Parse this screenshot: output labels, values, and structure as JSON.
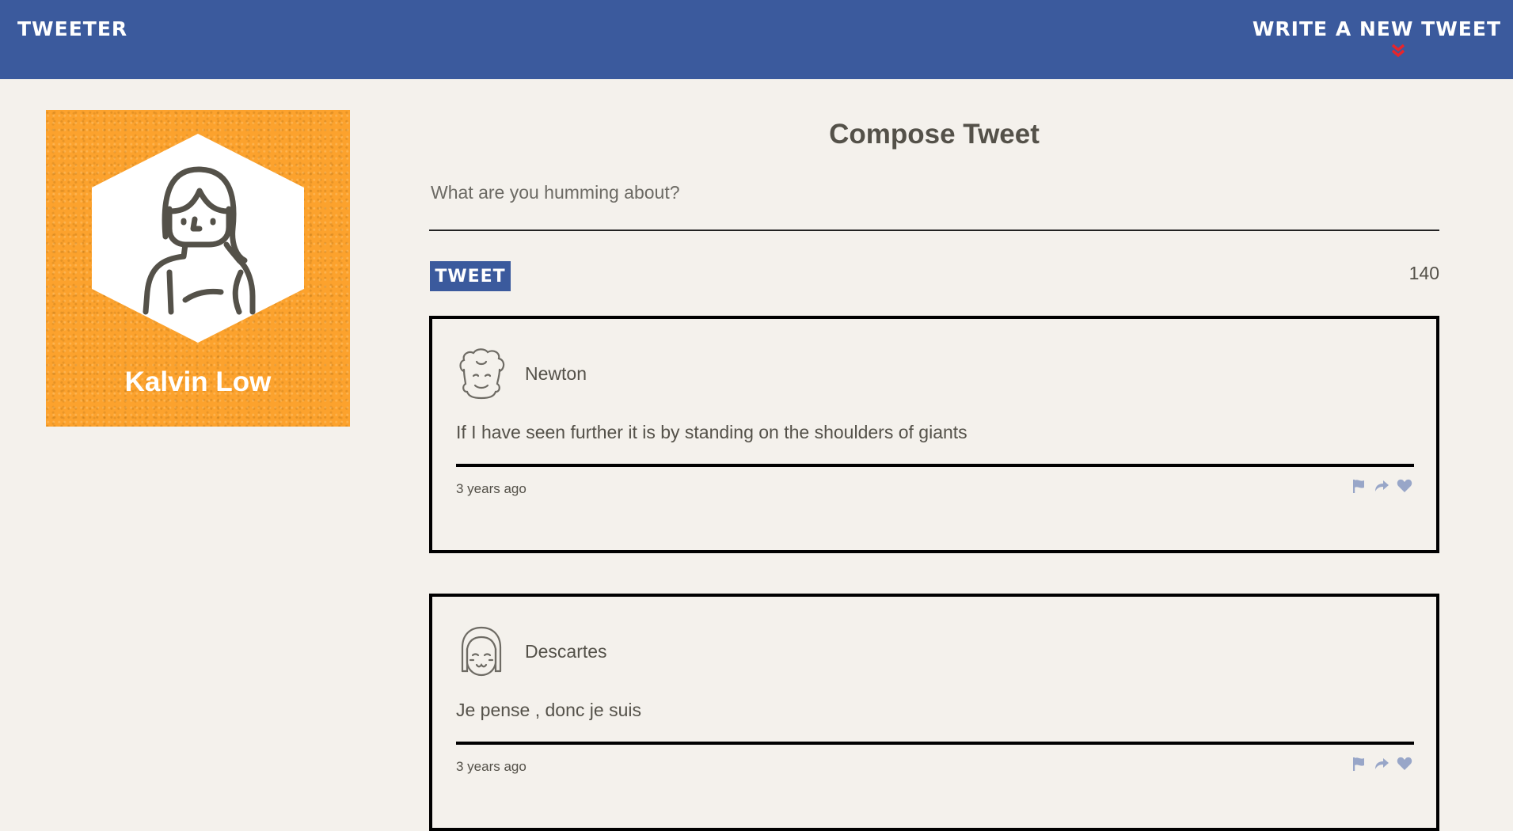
{
  "nav": {
    "brand": "TWEETER",
    "write_link": "WRITE A NEW TWEET",
    "chevron_icon": "double-chevron-down-icon",
    "accent_color": "#e8252b"
  },
  "profile": {
    "name": "Kalvin Low",
    "background_color": "#fca22d",
    "avatar_icon": "girl-avatar-icon"
  },
  "compose": {
    "title": "Compose Tweet",
    "placeholder": "What are you humming about?",
    "button_label": "TWEET",
    "char_count": "140"
  },
  "tweets": [
    {
      "handle": "Newton",
      "avatar_icon": "curly-hair-avatar-icon",
      "text": "If I have seen further it is by standing on the shoulders of giants",
      "time": "3 years ago",
      "actions": [
        "flag-icon",
        "retweet-icon",
        "heart-icon"
      ]
    },
    {
      "handle": "Descartes",
      "avatar_icon": "bob-hair-avatar-icon",
      "text": "Je pense , donc je suis",
      "time": "3 years ago",
      "actions": [
        "flag-icon",
        "retweet-icon",
        "heart-icon"
      ]
    }
  ],
  "colors": {
    "nav_bar": "#3b5a9d",
    "page_background": "#f4f1ec",
    "text": "#545149",
    "action_icons": "#98a6c8"
  }
}
